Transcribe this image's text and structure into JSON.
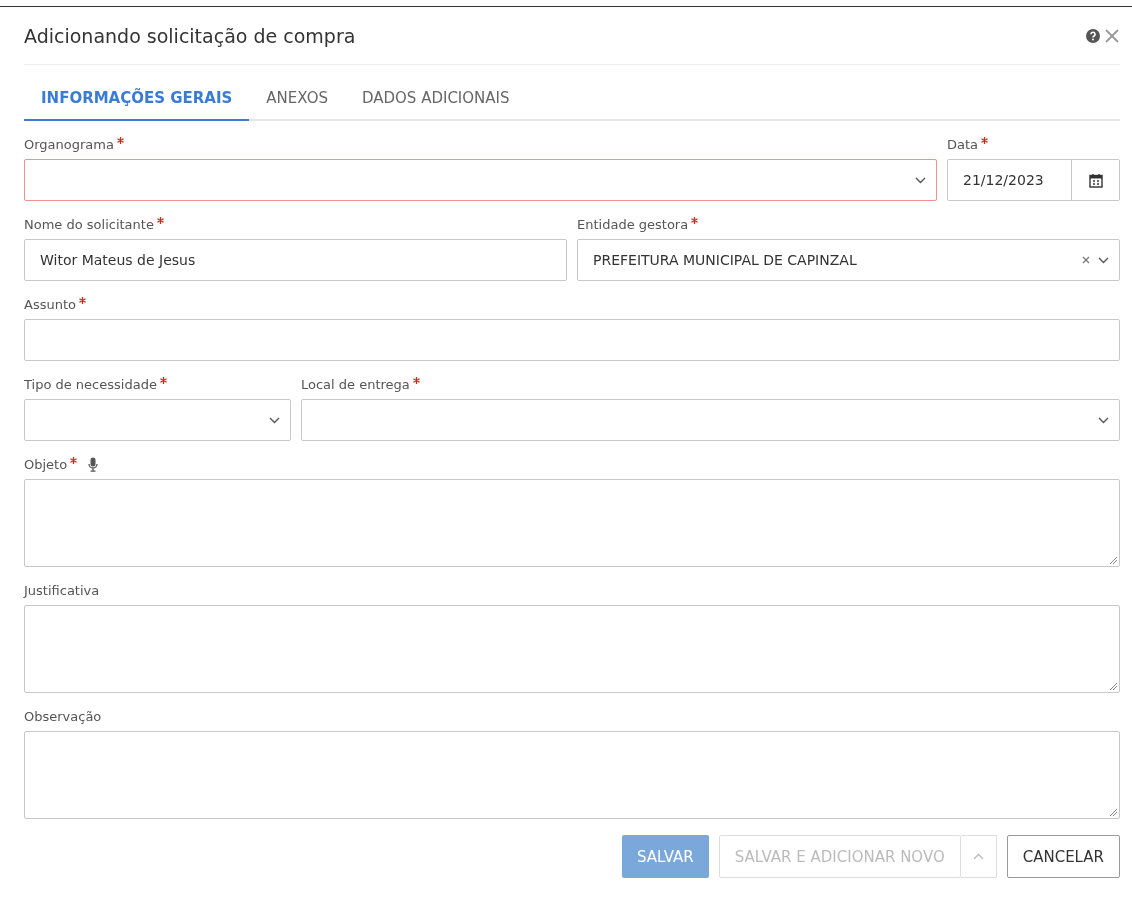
{
  "dialog": {
    "title": "Adicionando solicitação de compra"
  },
  "tabs": [
    {
      "label": "INFORMAÇÕES GERAIS",
      "selected": true
    },
    {
      "label": "ANEXOS",
      "selected": false
    },
    {
      "label": "DADOS ADICIONAIS",
      "selected": false
    }
  ],
  "rows": [
    {
      "fields": [
        {
          "kind": "select",
          "label": "Organograma",
          "required": true,
          "invalid": true
        },
        {
          "kind": "date",
          "label": "Data",
          "required": true,
          "value": "21/12/2023"
        }
      ]
    },
    {
      "fields": [
        {
          "kind": "text",
          "label": "Nome do solicitante",
          "required": true,
          "value": "Witor Mateus de Jesus"
        },
        {
          "kind": "select",
          "label": "Entidade gestora",
          "required": true,
          "value": "PREFEITURA MUNICIPAL DE CAPINZAL",
          "clearable": true
        }
      ]
    },
    {
      "fields": [
        {
          "kind": "text",
          "label": "Assunto",
          "required": true
        }
      ]
    },
    {
      "fields": [
        {
          "kind": "select",
          "label": "Tipo de necessidade",
          "required": true
        },
        {
          "kind": "select",
          "label": "Local de entrega",
          "required": true
        }
      ]
    },
    {
      "fields": [
        {
          "kind": "textarea",
          "label": "Objeto",
          "required": true,
          "mic": true
        }
      ]
    },
    {
      "fields": [
        {
          "kind": "textarea",
          "label": "Justificativa",
          "required": false
        }
      ]
    },
    {
      "fields": [
        {
          "kind": "textarea",
          "label": "Observação",
          "required": false
        }
      ]
    }
  ],
  "buttons": [
    {
      "kind": "primary",
      "label": "SALVAR",
      "disabled": true
    },
    {
      "kind": "split",
      "label": "SALVAR E ADICIONAR NOVO",
      "disabled": true
    },
    {
      "kind": "default",
      "label": "CANCELAR",
      "disabled": false
    }
  ]
}
